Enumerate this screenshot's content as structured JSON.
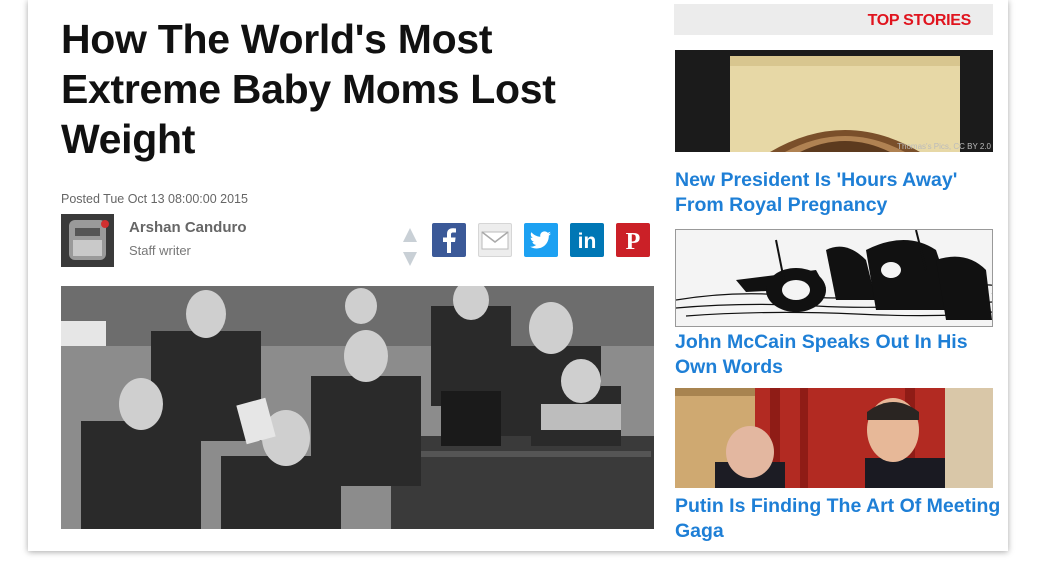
{
  "article": {
    "headline": "How The World's Most Extreme Baby Moms Lost Weight",
    "posted": "Posted Tue Oct 13 08:00:00 2015",
    "author": {
      "name": "Arshan Canduro",
      "role": "Staff writer"
    }
  },
  "share": [
    {
      "network": "facebook",
      "icon": "facebook-icon",
      "glyph": "f",
      "color": "#3b5998"
    },
    {
      "network": "email",
      "icon": "mail-icon",
      "glyph": "",
      "color": "#e8e8e8"
    },
    {
      "network": "twitter",
      "icon": "twitter-icon",
      "glyph": "",
      "color": "#1da1f2"
    },
    {
      "network": "linkedin",
      "icon": "linkedin-icon",
      "glyph": "in",
      "color": "#0077b5"
    },
    {
      "network": "pinterest",
      "icon": "pinterest-icon",
      "glyph": "P",
      "color": "#cb2027"
    }
  ],
  "sidebar": {
    "header": "TOP STORIES",
    "accent": "#e0141e",
    "link_color": "#1e7fd6",
    "stories": [
      {
        "title": "New President Is 'Hours Away' From Royal Pregnancy",
        "credit": "Thomas's Pics, CC BY 2.0"
      },
      {
        "title": "John McCain Speaks Out In His Own Words"
      },
      {
        "title": "Putin Is Finding The Art Of Meeting Gaga"
      }
    ]
  }
}
